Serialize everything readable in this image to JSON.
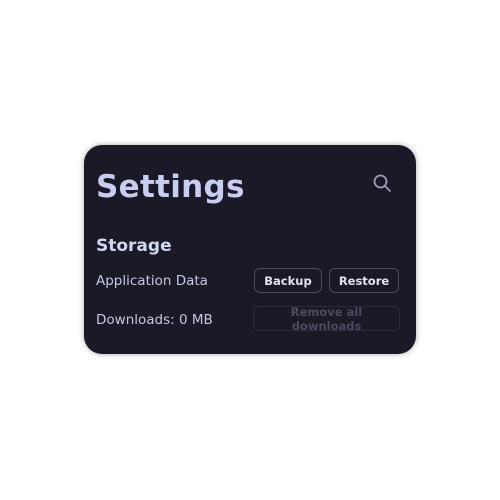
{
  "header": {
    "title": "Settings",
    "search_icon": "search-icon"
  },
  "storage": {
    "heading": "Storage",
    "application_data": {
      "label": "Application Data",
      "backup_label": "Backup",
      "restore_label": "Restore"
    },
    "downloads": {
      "label": "Downloads: 0 MB",
      "remove_label": "Remove all downloads",
      "remove_disabled": true
    }
  },
  "colors": {
    "card_bg": "#191a25",
    "title": "#c9cdf2",
    "text": "#c4c7e0"
  }
}
